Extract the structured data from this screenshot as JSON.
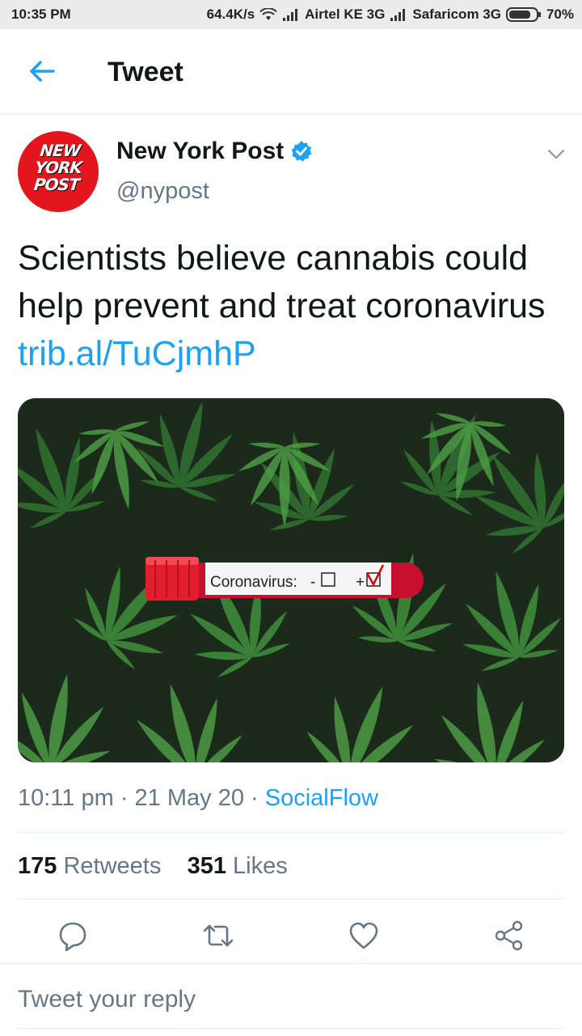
{
  "status_bar": {
    "time": "10:35 PM",
    "speed": "64.4K/s",
    "carrier1": "Airtel KE 3G",
    "carrier2": "Safaricom 3G",
    "battery": "70%"
  },
  "header": {
    "title": "Tweet"
  },
  "tweet": {
    "avatar_text": [
      "NEW",
      "YORK",
      "POST"
    ],
    "author_name": "New York Post",
    "handle": "@nypost",
    "text": "Scientists believe cannabis could help prevent and treat coronavirus",
    "link": "trib.al/TuCjmhP",
    "media_label": "Coronavirus:",
    "media_neg": "-",
    "media_pos": "+",
    "time": "10:11 pm",
    "date": "21 May 20",
    "source": "SocialFlow",
    "retweets_count": "175",
    "retweets_label": "Retweets",
    "likes_count": "351",
    "likes_label": "Likes"
  },
  "actions": {
    "reply": "reply-icon",
    "retweet": "retweet-icon",
    "like": "heart-icon",
    "share": "share-icon"
  },
  "reply_box": {
    "placeholder": "Tweet your reply"
  },
  "colors": {
    "accent": "#1da1f2",
    "text": "#14171a",
    "secondary": "#657786",
    "brand_red": "#e3161e"
  }
}
